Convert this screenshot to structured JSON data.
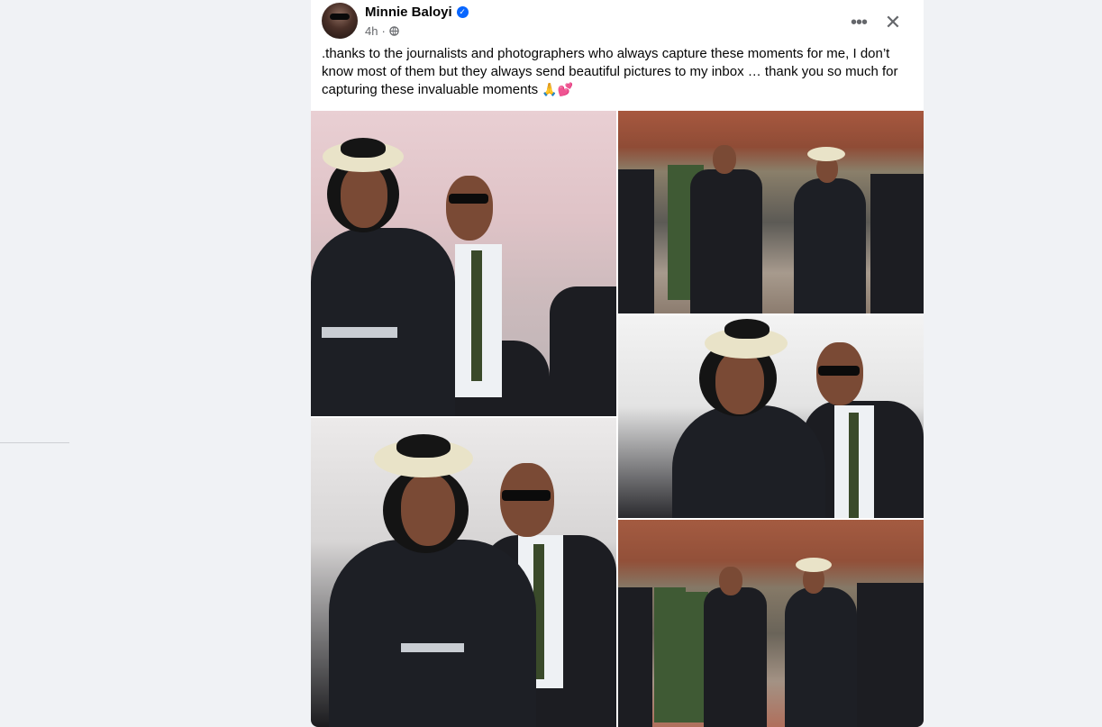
{
  "post": {
    "author": "Minnie Baloyi",
    "verified": true,
    "time": "4h",
    "audience_icon": "globe-icon",
    "more_icon": "more-icon",
    "close_icon": "close-icon",
    "text": ".thanks to the journalists and photographers who always capture these moments for me, I don’t know most of them but they always send beautiful pictures to my inbox … thank you so much for capturing these invaluable moments",
    "text_emoji": "🙏💕"
  },
  "colors": {
    "page_bg": "#f0f2f5",
    "card_bg": "#ffffff",
    "verified_blue": "#0866ff",
    "secondary_text": "#65676b"
  }
}
